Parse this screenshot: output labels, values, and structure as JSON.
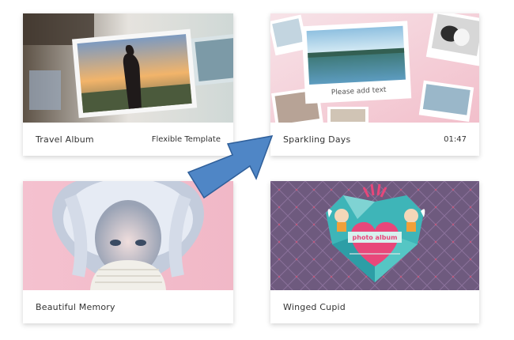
{
  "cards": [
    {
      "title": "Travel Album",
      "meta": "Flexible Template"
    },
    {
      "title": "Sparkling Days",
      "meta": "01:47",
      "thumb_text": "Please add text"
    },
    {
      "title": "Beautiful Memory",
      "meta": ""
    },
    {
      "title": "Winged Cupid",
      "meta": "",
      "thumb_text": "photo album"
    }
  ],
  "colors": {
    "arrow_fill": "#4f86c6",
    "arrow_stroke": "#2f5f9a",
    "cupid_bg": "#6e5a7e",
    "heart_pink": "#e8477a",
    "teal": "#3eb5b8",
    "pink_bg": "#f5c6d0"
  }
}
